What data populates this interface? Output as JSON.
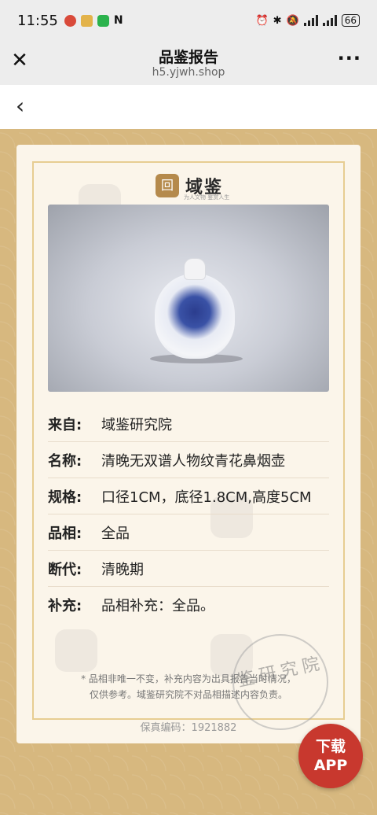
{
  "status_bar": {
    "time": "11:55",
    "battery": "66",
    "colors": {
      "app1": "#d94a3a",
      "app2": "#e3b34a",
      "wechat": "#2bb24c"
    }
  },
  "title_bar": {
    "close_icon": "close-icon",
    "title": "品鉴报告",
    "url": "h5.yjwh.shop",
    "more_icon": "more-icon"
  },
  "nav": {
    "back_icon": "chevron-left-icon"
  },
  "logo": {
    "text": "域鉴",
    "mark": "回",
    "sub": "为人文物 鉴赏人生"
  },
  "details": [
    {
      "label": "来自:",
      "value": "域鉴研究院"
    },
    {
      "label": "名称:",
      "value": "清晚无双谱人物纹青花鼻烟壶"
    },
    {
      "label": "规格:",
      "value": "口径1CM，底径1.8CM,高度5CM"
    },
    {
      "label": "品相:",
      "value": "全品"
    },
    {
      "label": "断代:",
      "value": "清晚期"
    },
    {
      "label": "补充:",
      "value": "品相补充：全品。"
    }
  ],
  "disclaimer": {
    "line1": "* 品相非唯一不变，补充内容为出具报告当时情况，",
    "line2": "仅供参考。域鉴研究院不对品相描述内容负责。"
  },
  "serial": "保真编码：1921882",
  "seal": {
    "text": "鉴研究院"
  },
  "app_button": {
    "line1": "下载",
    "line2": "APP"
  },
  "colors": {
    "background": "#d7b87f",
    "card": "#fbf5ea",
    "frame": "#e7cd92",
    "app_button": "#c8382e"
  }
}
